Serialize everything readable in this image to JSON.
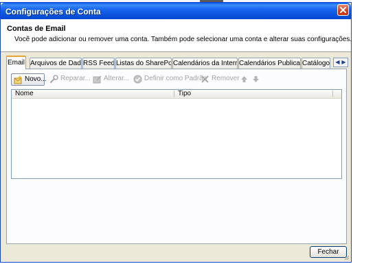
{
  "window": {
    "title": "Configurações de Conta"
  },
  "header": {
    "title": "Contas de Email",
    "description": "Você pode adicionar ou remover uma conta. Também pode selecionar uma conta e alterar suas configurações."
  },
  "tabs": [
    {
      "label": "Email",
      "active": true
    },
    {
      "label": "Arquivos de Dados",
      "active": false
    },
    {
      "label": "RSS Feeds",
      "active": false
    },
    {
      "label": "Listas do SharePoint",
      "active": false
    },
    {
      "label": "Calendários da Internet",
      "active": false
    },
    {
      "label": "Calendários Publicados",
      "active": false
    },
    {
      "label": "Catálogos",
      "active": false
    }
  ],
  "toolbar": {
    "new_label": "Novo...",
    "repair_label": "Reparar...",
    "change_label": "Alterar...",
    "set_default_label": "Definir como Padrão",
    "remove_label": "Remover",
    "move_up_icon": "arrow-up-icon",
    "move_down_icon": "arrow-down-icon"
  },
  "list": {
    "columns": [
      "Nome",
      "Tipo"
    ],
    "rows": []
  },
  "footer": {
    "close_label": "Fechar"
  },
  "colors": {
    "titlebar": "#0a5de6",
    "dialog_bg": "#ece9d8",
    "active_tab_accent": "#e8a337",
    "close_button": "#d4411e"
  }
}
